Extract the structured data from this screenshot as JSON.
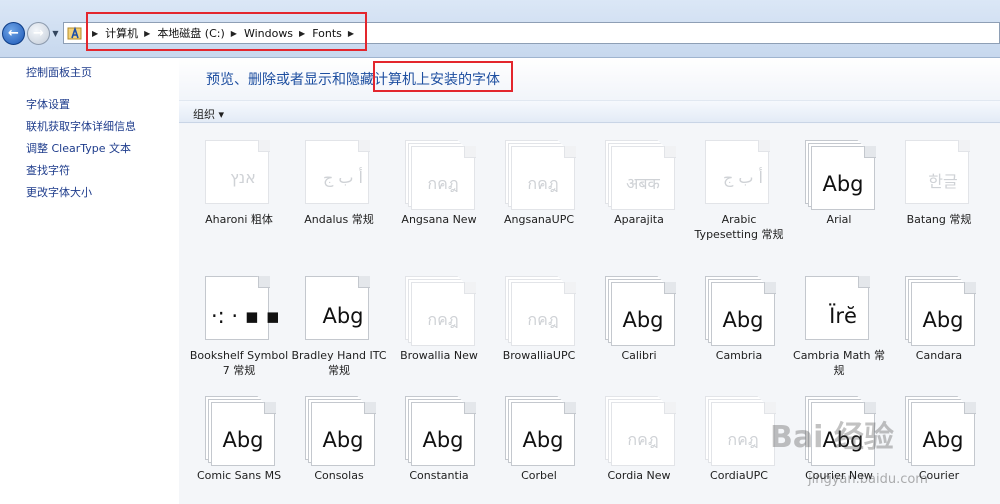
{
  "address_bar": {
    "crumbs": [
      "计算机",
      "本地磁盘 (C:)",
      "Windows",
      "Fonts"
    ]
  },
  "left_panel": {
    "links": [
      "控制面板主页",
      "字体设置",
      "联机获取字体详细信息",
      "调整 ClearType 文本",
      "查找字符",
      "更改字体大小"
    ]
  },
  "main": {
    "heading_prefix": "预览、删除或者显示和隐藏",
    "heading_highlight": "计算机上安装的字体",
    "toolbar": {
      "organize_label": "组织 ▾"
    },
    "fonts": [
      {
        "name": "Aharoni 粗体",
        "sample": "אנץ",
        "style": "single-light"
      },
      {
        "name": "Andalus 常规",
        "sample": "أ ب ج",
        "style": "single-light"
      },
      {
        "name": "Angsana New",
        "sample": "กคฎ",
        "style": "stack-light"
      },
      {
        "name": "AngsanaUPC",
        "sample": "กคฎ",
        "style": "stack-light"
      },
      {
        "name": "Aparajita",
        "sample": "अबक",
        "style": "stack-light"
      },
      {
        "name": "Arabic Typesetting 常规",
        "sample": "أ ب ج",
        "style": "single-light"
      },
      {
        "name": "Arial",
        "sample": "Abg",
        "style": "stack"
      },
      {
        "name": "Batang 常规",
        "sample": "한글",
        "style": "single-light"
      },
      {
        "name": "Bookshelf Symbol 7 常规",
        "sample": "·:  ·  ▪  ▪",
        "style": "single"
      },
      {
        "name": "Bradley Hand ITC 常规",
        "sample": "Abg",
        "style": "single"
      },
      {
        "name": "Browallia New",
        "sample": "กคฎ",
        "style": "stack-light"
      },
      {
        "name": "BrowalliaUPC",
        "sample": "กคฎ",
        "style": "stack-light"
      },
      {
        "name": "Calibri",
        "sample": "Abg",
        "style": "stack"
      },
      {
        "name": "Cambria",
        "sample": "Abg",
        "style": "stack"
      },
      {
        "name": "Cambria Math 常规",
        "sample": "Ïrĕ",
        "style": "single"
      },
      {
        "name": "Candara",
        "sample": "Abg",
        "style": "stack"
      },
      {
        "name": "Comic Sans MS",
        "sample": "Abg",
        "style": "stack"
      },
      {
        "name": "Consolas",
        "sample": "Abg",
        "style": "stack"
      },
      {
        "name": "Constantia",
        "sample": "Abg",
        "style": "stack"
      },
      {
        "name": "Corbel",
        "sample": "Abg",
        "style": "stack"
      },
      {
        "name": "Cordia New",
        "sample": "กคฎ",
        "style": "stack-light"
      },
      {
        "name": "CordiaUPC",
        "sample": "กคฎ",
        "style": "stack-light"
      },
      {
        "name": "Courier New",
        "sample": "Abg",
        "style": "stack"
      },
      {
        "name": "Courier",
        "sample": "Abg",
        "style": "stack"
      }
    ]
  },
  "watermark": {
    "text": "Bai 经验",
    "url": "jingyan.baidu.com"
  }
}
